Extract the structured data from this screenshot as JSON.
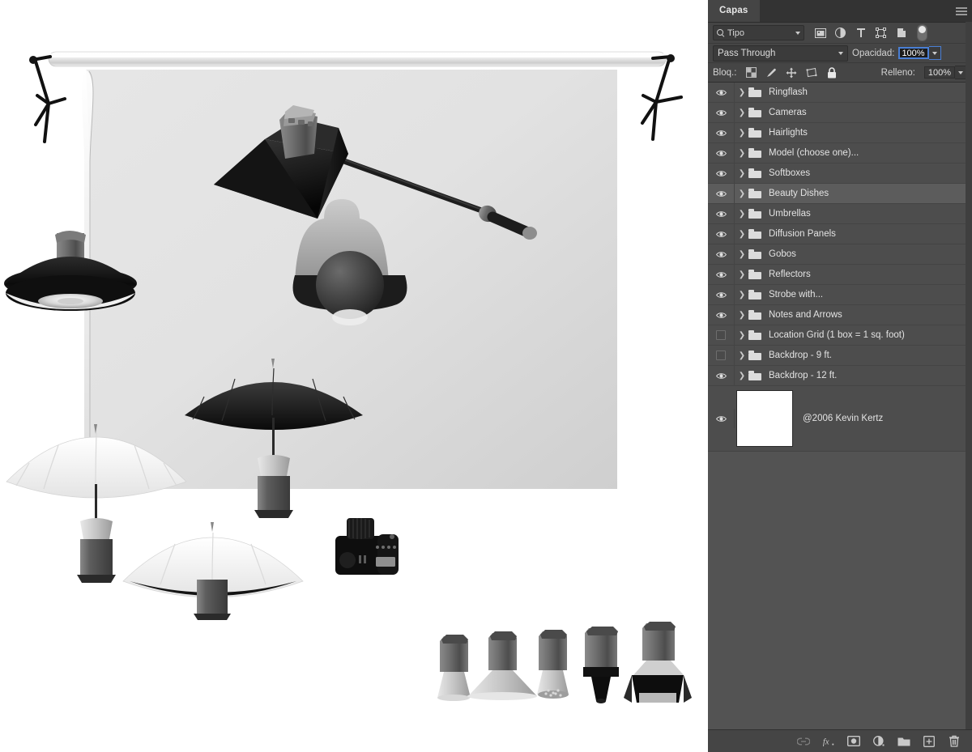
{
  "panel": {
    "tab_label": "Capas",
    "menu_icon": "hamburger-menu-icon",
    "filter": {
      "search_icon": "search-icon",
      "value": "Tipo",
      "icons": [
        {
          "name": "pixel-layer-filter-icon",
          "glyph": "image"
        },
        {
          "name": "adjustment-layer-filter-icon",
          "glyph": "half-circle"
        },
        {
          "name": "type-layer-filter-icon",
          "glyph": "T"
        },
        {
          "name": "shape-layer-filter-icon",
          "glyph": "shape"
        },
        {
          "name": "smart-object-filter-icon",
          "glyph": "smart"
        }
      ],
      "toggle_name": "filter-enable-toggle"
    },
    "blend": {
      "mode": "Pass Through",
      "opacity_label": "Opacidad:",
      "opacity_value": "100%"
    },
    "lock": {
      "label": "Bloq.:",
      "icons": [
        {
          "name": "lock-transparent-pixels-icon"
        },
        {
          "name": "lock-image-pixels-icon"
        },
        {
          "name": "lock-position-icon"
        },
        {
          "name": "lock-artboard-nesting-icon"
        },
        {
          "name": "lock-all-icon"
        }
      ],
      "fill_label": "Relleno:",
      "fill_value": "100%"
    },
    "layers": [
      {
        "name": "Ringflash",
        "visible": true,
        "selected": false,
        "type": "group"
      },
      {
        "name": "Cameras",
        "visible": true,
        "selected": false,
        "type": "group"
      },
      {
        "name": "Hairlights",
        "visible": true,
        "selected": false,
        "type": "group"
      },
      {
        "name": "Model (choose one)...",
        "visible": true,
        "selected": false,
        "type": "group"
      },
      {
        "name": "Softboxes",
        "visible": true,
        "selected": false,
        "type": "group"
      },
      {
        "name": "Beauty Dishes",
        "visible": true,
        "selected": true,
        "type": "group"
      },
      {
        "name": "Umbrellas",
        "visible": true,
        "selected": false,
        "type": "group"
      },
      {
        "name": "Diffusion Panels",
        "visible": true,
        "selected": false,
        "type": "group"
      },
      {
        "name": "Gobos",
        "visible": true,
        "selected": false,
        "type": "group"
      },
      {
        "name": "Reflectors",
        "visible": true,
        "selected": false,
        "type": "group"
      },
      {
        "name": "Strobe with...",
        "visible": true,
        "selected": false,
        "type": "group"
      },
      {
        "name": "Notes and Arrows",
        "visible": true,
        "selected": false,
        "type": "group"
      },
      {
        "name": "Location Grid (1 box = 1 sq. foot)",
        "visible": false,
        "selected": false,
        "type": "group"
      },
      {
        "name": "Backdrop - 9 ft.",
        "visible": false,
        "selected": false,
        "type": "group"
      },
      {
        "name": "Backdrop - 12 ft.",
        "visible": true,
        "selected": false,
        "type": "group"
      }
    ],
    "image_layer": {
      "name": "@2006 Kevin Kertz",
      "visible": true,
      "thumbnail_color": "#ffffff"
    },
    "bottom_bar": [
      {
        "name": "link-layers-button",
        "glyph": "link",
        "enabled": false
      },
      {
        "name": "add-layer-style-button",
        "glyph": "fx",
        "enabled": true
      },
      {
        "name": "add-layer-mask-button",
        "glyph": "mask",
        "enabled": true
      },
      {
        "name": "new-adjustment-layer-button",
        "glyph": "adjust",
        "enabled": true
      },
      {
        "name": "new-group-button",
        "glyph": "folder",
        "enabled": true
      },
      {
        "name": "new-layer-button",
        "glyph": "newlayer",
        "enabled": true
      },
      {
        "name": "delete-layer-button",
        "glyph": "trash",
        "enabled": true
      }
    ],
    "colors": {
      "panel_bg": "#535353",
      "toolbar_bg": "#454545",
      "row_bg": "#4d4d4d",
      "row_selected_bg": "#5c5c5c",
      "tab_bg": "#333333",
      "text": "#e3e3e3",
      "accent_blue": "#4a7fd4"
    }
  },
  "canvas": {
    "title": "studio-lighting-diagram",
    "description": "Photography studio lighting setup diagram: seamless backdrop on stands, beauty dish on boom arm, model figure, umbrellas, reflector dish, DSLR camera and a row of five strobe heads with modifiers.",
    "objects": [
      {
        "name": "backdrop-paper-roll"
      },
      {
        "name": "backdrop-stand-left"
      },
      {
        "name": "backdrop-stand-right"
      },
      {
        "name": "beauty-dish-on-boom"
      },
      {
        "name": "model-figure"
      },
      {
        "name": "reflector-dish-light"
      },
      {
        "name": "black-umbrella"
      },
      {
        "name": "white-umbrella-left"
      },
      {
        "name": "white-umbrella-bottom"
      },
      {
        "name": "dslr-camera"
      },
      {
        "name": "strobe-head-reflector"
      },
      {
        "name": "strobe-head-wide-reflector"
      },
      {
        "name": "strobe-head-grid"
      },
      {
        "name": "strobe-head-snoot"
      },
      {
        "name": "strobe-head-barndoors"
      }
    ]
  }
}
